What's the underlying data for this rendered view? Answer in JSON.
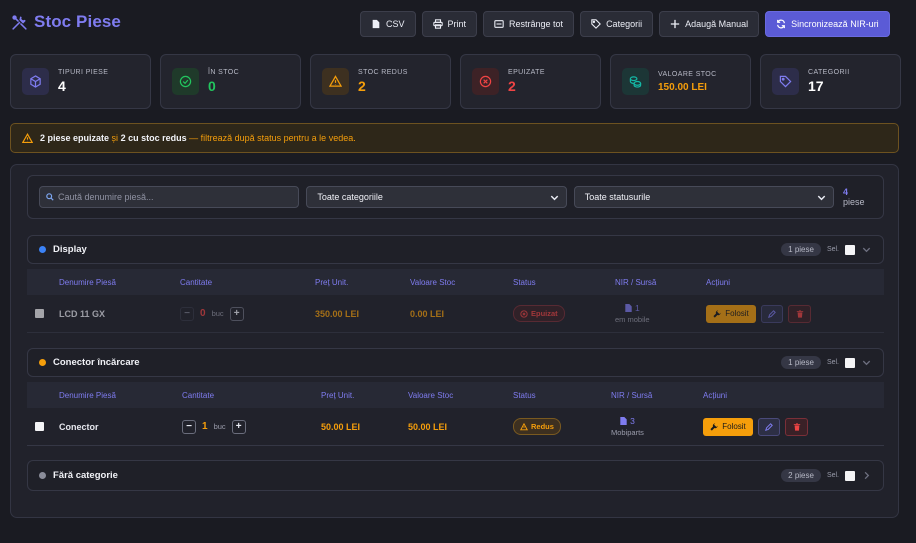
{
  "app": {
    "title": "Stoc Piese"
  },
  "toolbar": {
    "csv": "CSV",
    "print": "Print",
    "collapse": "Restrânge tot",
    "categories": "Categorii",
    "add_manual": "Adaugă Manual",
    "sync_nir": "Sincronizează NIR-uri"
  },
  "stats": [
    {
      "label": "TIPURI PIESE",
      "value": "4",
      "color": "#ffffff",
      "icon_color": "#7f7cf0",
      "icon_bg": "#2d2d4a"
    },
    {
      "label": "ÎN STOC",
      "value": "0",
      "color": "#22c55e",
      "icon_color": "#22c55e",
      "icon_bg": "#1f3a2a"
    },
    {
      "label": "STOC REDUS",
      "value": "2",
      "color": "#f59e0b",
      "icon_color": "#f59e0b",
      "icon_bg": "#3d3020"
    },
    {
      "label": "EPUIZATE",
      "value": "2",
      "color": "#ef4444",
      "icon_color": "#ef4444",
      "icon_bg": "#3d2226"
    },
    {
      "label": "VALOARE STOC",
      "value": "150.00 LEI",
      "color": "#f59e0b",
      "icon_color": "#14b8a6",
      "icon_bg": "#1c3636"
    },
    {
      "label": "CATEGORII",
      "value": "17",
      "color": "#ffffff",
      "icon_color": "#7f7cf0",
      "icon_bg": "#2d2d4a"
    }
  ],
  "alert": {
    "count_depleted": "2 piese epuizate",
    "and": "și",
    "count_low": "2 cu stoc redus",
    "hint": "— filtrează după status pentru a le vedea."
  },
  "filters": {
    "search_placeholder": "Caută denumire piesă...",
    "category": "Toate categoriile",
    "status": "Toate statusurile",
    "count_number": "4",
    "count_label": "piese"
  },
  "table_headers": {
    "name": "Denumire Piesă",
    "qty": "Cantitate",
    "unit_price": "Preț Unit.",
    "stock_value": "Valoare Stoc",
    "status": "Status",
    "nir": "NIR / Sursă",
    "actions": "Acțiuni"
  },
  "groups": [
    {
      "name": "Display",
      "dot": "#3b82f6",
      "count": "1 piese",
      "sel": "Sel.",
      "rows": [
        {
          "name": "LCD 11 GX",
          "qty": "0",
          "unit": "buc",
          "price": "350.00 LEI",
          "value": "0.00 LEI",
          "status": "Epuizat",
          "nir": "1",
          "source": "em mobile",
          "use": "Folosit"
        }
      ]
    },
    {
      "name": "Conector încărcare",
      "dot": "#f59e0b",
      "count": "1 piese",
      "sel": "Sel.",
      "rows": [
        {
          "name": "Conector",
          "qty": "1",
          "unit": "buc",
          "price": "50.00 LEI",
          "value": "50.00 LEI",
          "status": "Redus",
          "nir": "3",
          "source": "Mobiparts",
          "use": "Folosit"
        }
      ]
    },
    {
      "name": "Fără categorie",
      "dot": "#8a8c99",
      "count": "2 piese",
      "sel": "Sel.",
      "rows": []
    }
  ]
}
